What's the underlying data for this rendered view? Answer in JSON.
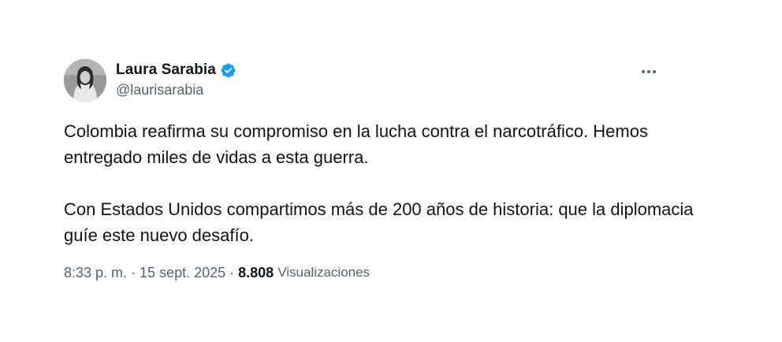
{
  "author": {
    "name": "Laura Sarabia",
    "handle": "@laurisarabia",
    "verified": true,
    "avatar": "profile-photo"
  },
  "menu": {
    "icon": "more-horizontal-icon"
  },
  "tweet": {
    "paragraphs": [
      "Colombia reafirma su compromiso en la lucha contra el narcotráfico. Hemos entregado miles de vidas a esta guerra.",
      "Con Estados Unidos compartimos más de 200 años de historia: que la diplomacia guíe este nuevo desafío."
    ]
  },
  "meta": {
    "time": "8:33 p. m.",
    "separator": "·",
    "date": "15 sept. 2025",
    "views_count": "8.808",
    "views_label": "Visualizaciones"
  },
  "colors": {
    "text_primary": "#0f1419",
    "text_secondary": "#536471",
    "verified_blue": "#1d9bf0",
    "background": "#ffffff"
  }
}
